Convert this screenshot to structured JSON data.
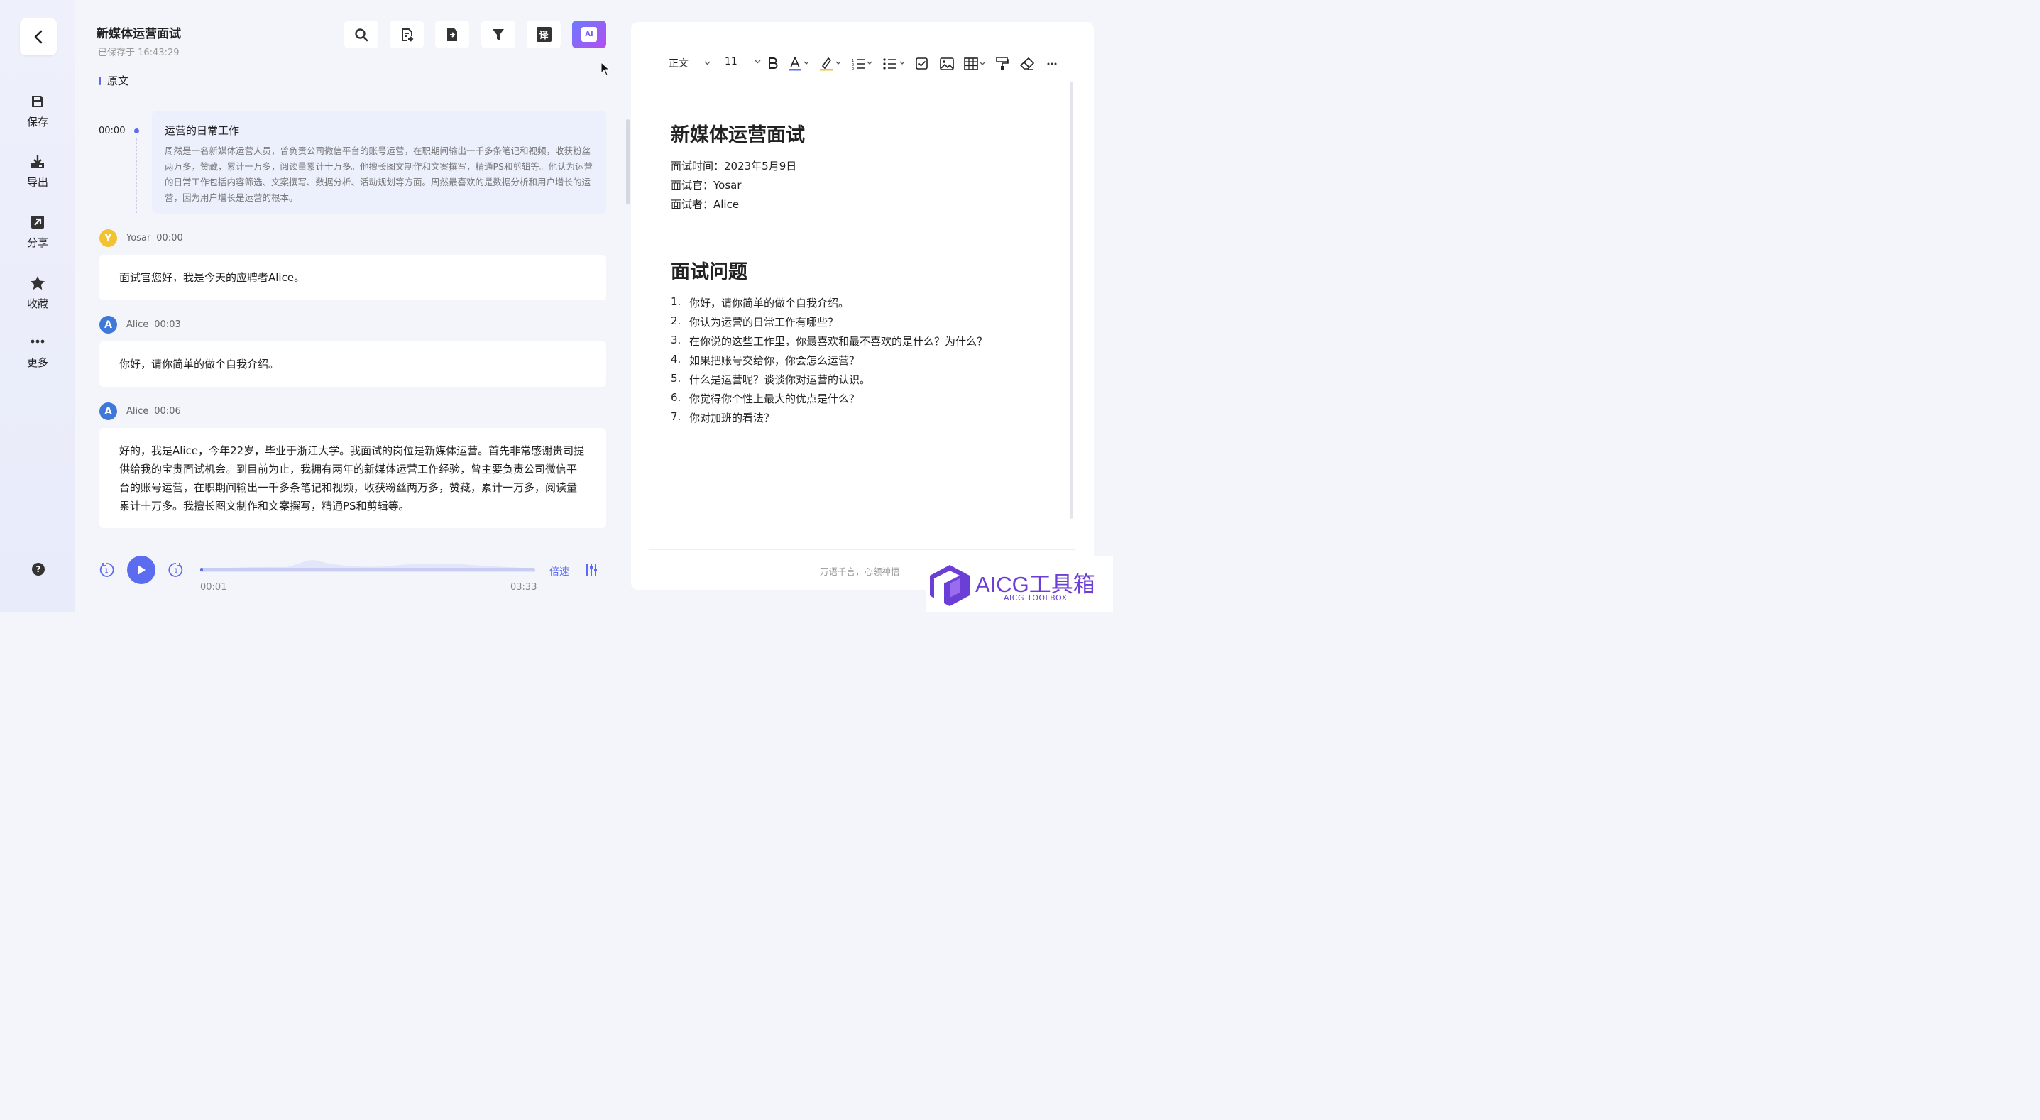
{
  "sidebar": {
    "items": [
      {
        "label": "保存",
        "icon": "save-icon"
      },
      {
        "label": "导出",
        "icon": "export-icon"
      },
      {
        "label": "分享",
        "icon": "share-icon"
      },
      {
        "label": "收藏",
        "icon": "star-icon"
      },
      {
        "label": "更多",
        "icon": "more-icon"
      }
    ],
    "help": "?"
  },
  "header": {
    "title": "新媒体运营面试",
    "saved": "已保存于 16:43:29",
    "translate_label": "译",
    "ai_label": "AI"
  },
  "section": {
    "label": "原文"
  },
  "summary": {
    "time": "00:00",
    "title": "运营的日常工作",
    "body": "周然是一名新媒体运营人员，曾负责公司微信平台的账号运营，在职期间输出一千多条笔记和视频，收获粉丝两万多，赞藏，累计一万多，阅读量累计十万多。他擅长图文制作和文案撰写，精通PS和剪辑等。他认为运营的日常工作包括内容筛选、文案撰写、数据分析、活动规划等方面。周然最喜欢的是数据分析和用户增长的运营，因为用户增长是运营的根本。"
  },
  "transcript": [
    {
      "avatar": "Y",
      "speaker": "Yosar",
      "time": "00:00",
      "text": "面试官您好，我是今天的应聘者Alice。"
    },
    {
      "avatar": "A",
      "speaker": "Alice",
      "time": "00:03",
      "text": "你好，请你简单的做个自我介绍。"
    },
    {
      "avatar": "A",
      "speaker": "Alice",
      "time": "00:06",
      "text": "好的，我是Alice，今年22岁，毕业于浙江大学。我面试的岗位是新媒体运营。首先非常感谢贵司提供给我的宝贵面试机会。到目前为止，我拥有两年的新媒体运营工作经验，曾主要负责公司微信平台的账号运营，在职期间输出一千多条笔记和视频，收获粉丝两万多，赞藏，累计一万多，阅读量累计十万多。我擅长图文制作和文案撰写，精通PS和剪辑等。"
    }
  ],
  "player": {
    "speed_label": "倍速",
    "current": "00:01",
    "total": "03:33",
    "progress_fraction": 0.005
  },
  "editor": {
    "style_select": "正文",
    "font_size": "11",
    "title": "新媒体运营面试",
    "meta": [
      "面试时间：2023年5月9日",
      "面试官：Yosar",
      "面试者：Alice"
    ],
    "section_title": "面试问题",
    "questions": [
      "你好，请你简单的做个自我介绍。",
      "你认为运营的日常工作有哪些？",
      "在你说的这些工作里，你最喜欢和最不喜欢的是什么？为什么？",
      "如果把账号交给你，你会怎么运营？",
      "什么是运营呢？谈谈你对运营的认识。",
      "你觉得你个性上最大的优点是什么？",
      "你对加班的看法？"
    ],
    "footer": "万语千言，心领神悟"
  },
  "watermark": {
    "text": "AICG工具箱",
    "sub": "AICG TOOLBOX"
  },
  "colors": {
    "accent": "#5b6cf0",
    "highlight": "#f2c230",
    "brand": "#6b3fd6"
  }
}
